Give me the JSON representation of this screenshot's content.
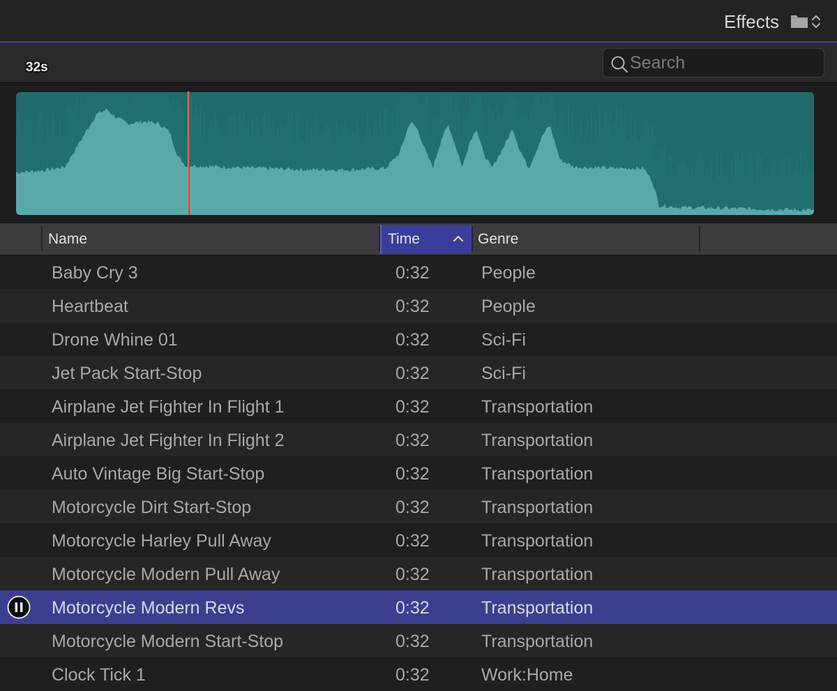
{
  "header": {
    "title": "Effects",
    "icons": [
      "folder-icon",
      "stepper-icon"
    ]
  },
  "search": {
    "placeholder": "Search",
    "value": ""
  },
  "preview": {
    "duration_label": "32s"
  },
  "columns": [
    {
      "label": "Name"
    },
    {
      "label": "Time",
      "sorted": "ascending"
    },
    {
      "label": "Genre"
    }
  ],
  "rows": [
    {
      "name": "Baby Cry 3",
      "time": "0:32",
      "genre": "People"
    },
    {
      "name": "Heartbeat",
      "time": "0:32",
      "genre": "People"
    },
    {
      "name": "Drone Whine 01",
      "time": "0:32",
      "genre": "Sci-Fi"
    },
    {
      "name": "Jet Pack Start-Stop",
      "time": "0:32",
      "genre": "Sci-Fi"
    },
    {
      "name": "Airplane Jet Fighter In Flight 1",
      "time": "0:32",
      "genre": "Transportation"
    },
    {
      "name": "Airplane Jet Fighter In Flight 2",
      "time": "0:32",
      "genre": "Transportation"
    },
    {
      "name": "Auto Vintage Big Start-Stop",
      "time": "0:32",
      "genre": "Transportation"
    },
    {
      "name": "Motorcycle Dirt Start-Stop",
      "time": "0:32",
      "genre": "Transportation"
    },
    {
      "name": "Motorcycle Harley Pull Away",
      "time": "0:32",
      "genre": "Transportation"
    },
    {
      "name": "Motorcycle Modern Pull Away",
      "time": "0:32",
      "genre": "Transportation"
    },
    {
      "name": "Motorcycle Modern Revs",
      "time": "0:32",
      "genre": "Transportation",
      "selected": true,
      "playing": true
    },
    {
      "name": "Motorcycle Modern Start-Stop",
      "time": "0:32",
      "genre": "Transportation"
    },
    {
      "name": "Clock Tick 1",
      "time": "0:32",
      "genre": "Work:Home"
    }
  ],
  "colors": {
    "accent": "#3d3fa6",
    "selection": "#3b3f8f",
    "waveform_light": "#5aa9aa",
    "waveform_dark": "#1f6b6e",
    "playhead": "#c0522e"
  }
}
